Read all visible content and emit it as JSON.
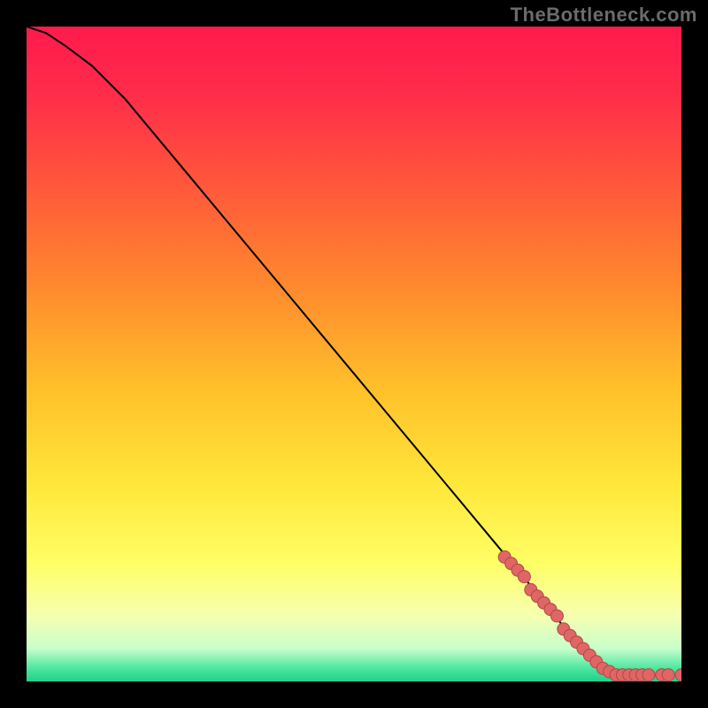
{
  "watermark": "TheBottleneck.com",
  "colors": {
    "background": "#000000",
    "curve": "#000000",
    "marker_fill": "#e06666",
    "marker_stroke": "#b04848",
    "gradient_stops": [
      {
        "offset": 0.0,
        "color": "#ff1a4d"
      },
      {
        "offset": 0.1,
        "color": "#ff2b4a"
      },
      {
        "offset": 0.25,
        "color": "#ff5a3a"
      },
      {
        "offset": 0.4,
        "color": "#ff8a2e"
      },
      {
        "offset": 0.55,
        "color": "#ffbf2a"
      },
      {
        "offset": 0.7,
        "color": "#ffe73a"
      },
      {
        "offset": 0.82,
        "color": "#ffff66"
      },
      {
        "offset": 0.9,
        "color": "#f6ffb0"
      },
      {
        "offset": 0.95,
        "color": "#c8ffcc"
      },
      {
        "offset": 0.98,
        "color": "#4de6a0"
      },
      {
        "offset": 1.0,
        "color": "#1fd18a"
      }
    ]
  },
  "chart_data": {
    "type": "line",
    "title": "",
    "xlabel": "",
    "ylabel": "",
    "xlim": [
      0,
      100
    ],
    "ylim": [
      0,
      100
    ],
    "series": [
      {
        "name": "curve",
        "x": [
          0,
          3,
          6,
          10,
          15,
          20,
          25,
          30,
          35,
          40,
          45,
          50,
          55,
          60,
          65,
          70,
          75,
          80,
          83,
          86,
          88,
          90,
          92,
          95,
          98,
          100
        ],
        "y": [
          100,
          99,
          97,
          94,
          89,
          83,
          77,
          71,
          65,
          59,
          53,
          47,
          41,
          35,
          29,
          23,
          17,
          11,
          7,
          4,
          2,
          1,
          1,
          1,
          1,
          1
        ]
      }
    ],
    "markers": {
      "name": "highlighted-points",
      "x": [
        73,
        74,
        75,
        76,
        77,
        78,
        79,
        80,
        81,
        82,
        83,
        84,
        85,
        86,
        87,
        88,
        89,
        90,
        91,
        92,
        93,
        94,
        95,
        97,
        98,
        100
      ],
      "y": [
        19,
        18,
        17,
        16,
        14,
        13,
        12,
        11,
        10,
        8,
        7,
        6,
        5,
        4,
        3,
        2,
        1.5,
        1,
        1,
        1,
        1,
        1,
        1,
        1,
        1,
        1
      ]
    }
  }
}
